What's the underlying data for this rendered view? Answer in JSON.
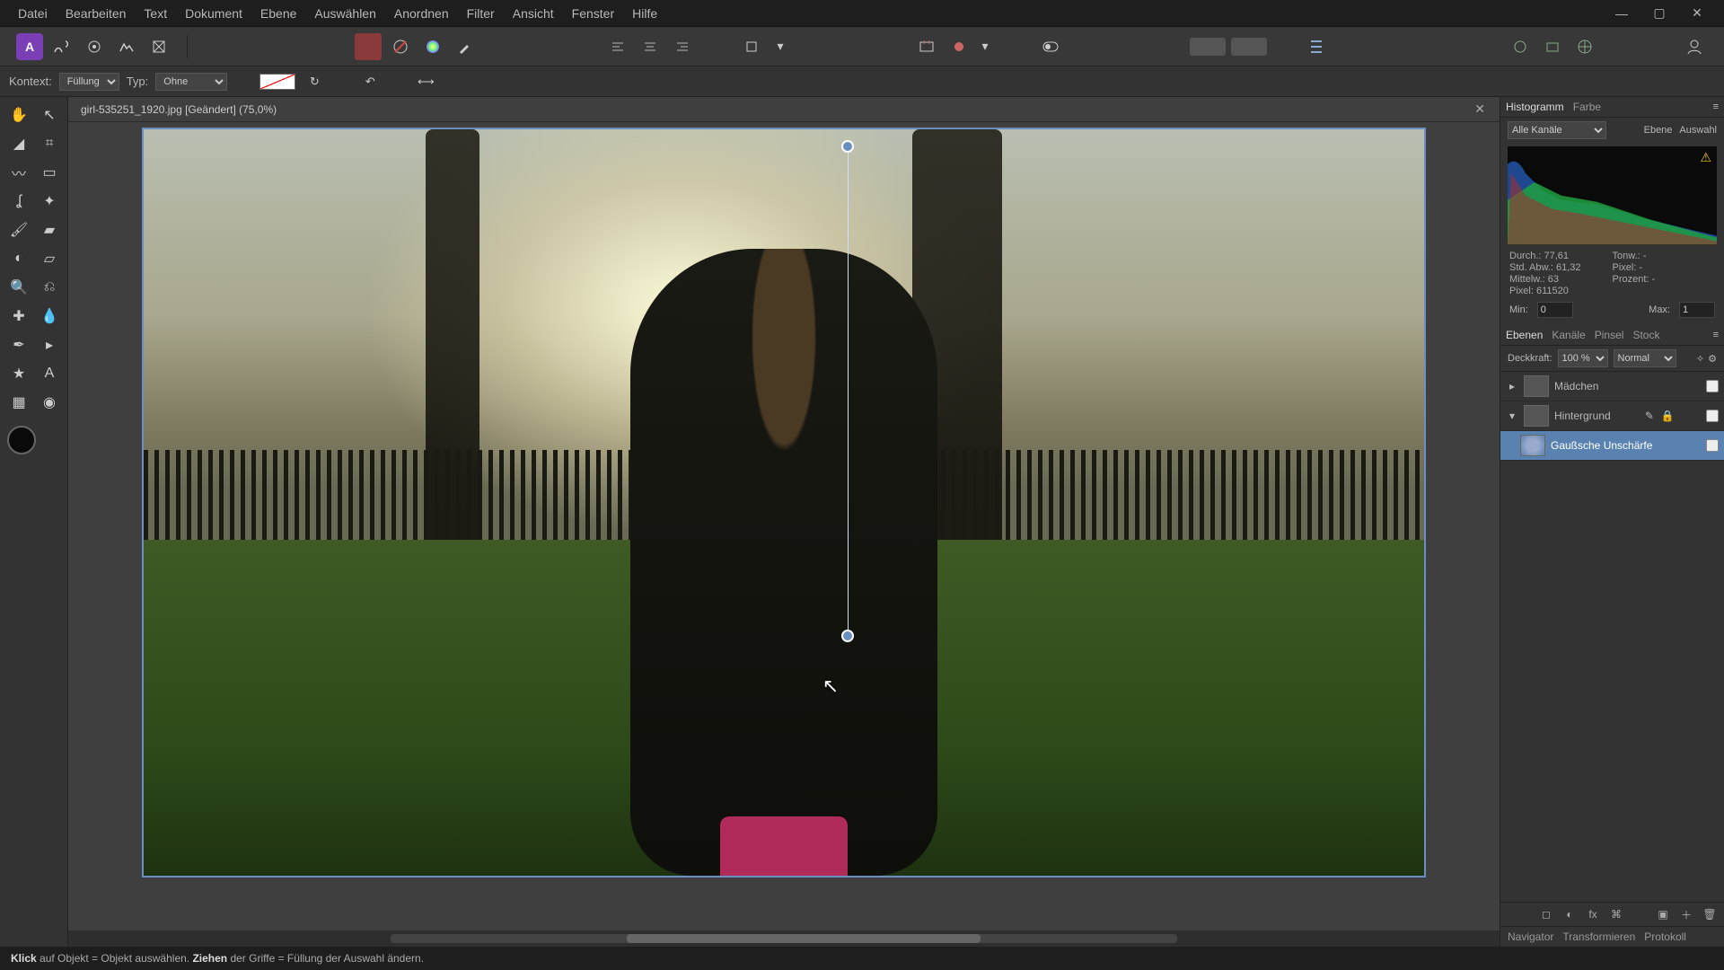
{
  "menu": [
    "Datei",
    "Bearbeiten",
    "Text",
    "Dokument",
    "Ebene",
    "Auswählen",
    "Anordnen",
    "Filter",
    "Ansicht",
    "Fenster",
    "Hilfe"
  ],
  "context": {
    "label": "Kontext:",
    "fill_label": "Füllung",
    "type_label": "Typ:",
    "type_value": "Ohne"
  },
  "document": {
    "tab_title": "girl-535251_1920.jpg [Geändert] (75,0%)"
  },
  "histogram_panel": {
    "tabs": [
      "Histogramm",
      "Farbe"
    ],
    "mini_tabs": [
      "Ebene",
      "Auswahl"
    ],
    "channel_select": "Alle Kanäle",
    "stats": {
      "durch": "Durch.: 77,61",
      "stdabw": "Std. Abw.: 61,32",
      "mittelw": "Mittelw.: 63",
      "pixel": "Pixel: 611520",
      "tonw": "Tonw.: -",
      "anzahl": "Pixel: -",
      "prozent": "Prozent: -"
    },
    "min_label": "Min:",
    "min_value": "0",
    "max_label": "Max:",
    "max_value": "1"
  },
  "layers_panel": {
    "tabs": [
      "Ebenen",
      "Kanäle",
      "Pinsel",
      "Stock"
    ],
    "opacity_label": "Deckkraft:",
    "opacity_value": "100 %",
    "blend_mode": "Normal",
    "layers": [
      {
        "name": "Mädchen",
        "selected": false,
        "child": false
      },
      {
        "name": "Hintergrund",
        "selected": false,
        "child": false
      },
      {
        "name": "Gaußsche Unschärfe",
        "selected": true,
        "child": true
      }
    ]
  },
  "bottom_panel_tabs": [
    "Navigator",
    "Transformieren",
    "Protokoll"
  ],
  "statusbar": {
    "t1": "Klick",
    "t2": " auf Objekt = Objekt auswählen. ",
    "t3": "Ziehen",
    "t4": " der Griffe = Füllung der Auswahl ändern."
  }
}
